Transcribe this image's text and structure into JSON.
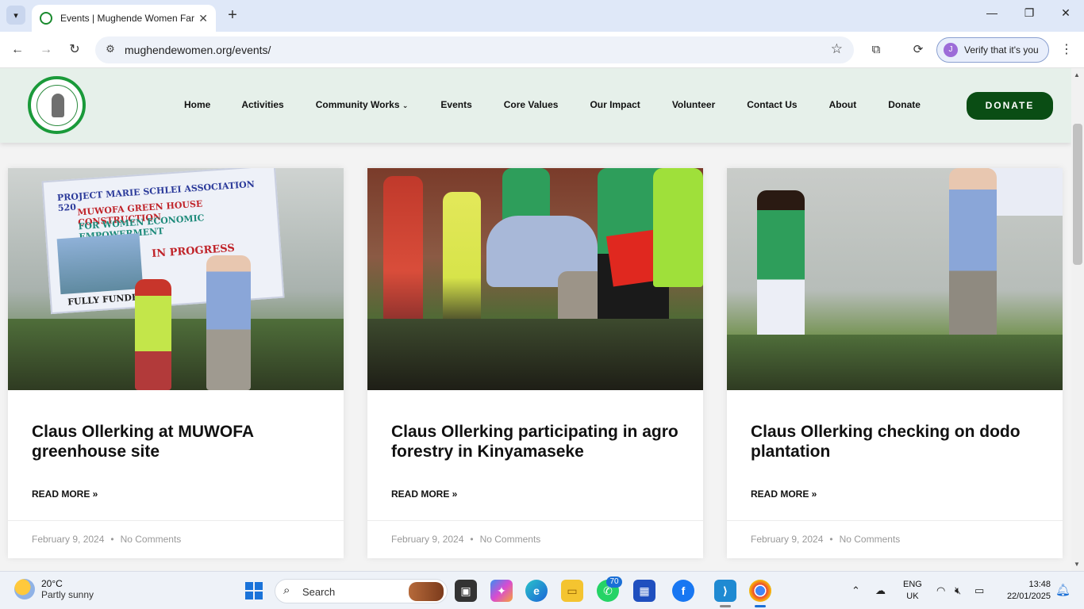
{
  "browser": {
    "tab_title": "Events | Mughende Women Far",
    "url": "mughendewomen.org/events/",
    "verify_label": "Verify that it's you",
    "avatar_letter": "J"
  },
  "site": {
    "nav": [
      "Home",
      "Activities",
      "Community Works",
      "Events",
      "Core Values",
      "Our Impact",
      "Volunteer",
      "Contact Us",
      "About",
      "Donate"
    ],
    "donate_button": "DONATE"
  },
  "posts": [
    {
      "title": "Claus Ollerking at  MUWOFA greenhouse site",
      "read_more": "READ MORE »",
      "date": "February 9, 2024",
      "comments": "No Comments"
    },
    {
      "title": "Claus Ollerking participating in agro forestry in Kinyamaseke",
      "read_more": "READ MORE »",
      "date": "February 9, 2024",
      "comments": "No Comments"
    },
    {
      "title": "Claus Ollerking checking on dodo plantation",
      "read_more": "READ MORE »",
      "date": "February 9, 2024",
      "comments": "No Comments"
    }
  ],
  "banner_text": {
    "line1": "PROJECT MARIE SCHLEI ASSOCIATION 520",
    "line2": "MUWOFA GREEN HOUSE CONSTRUCTION",
    "line3": "FOR WOMEN ECONOMIC EMPOWERMENT",
    "line4": "IN PROGRESS",
    "line5": "FULLY FUNDED BY;"
  },
  "taskbar": {
    "temperature": "20°C",
    "weather": "Partly sunny",
    "search_label": "Search",
    "whatsapp_badge": "70",
    "lang_top": "ENG",
    "lang_bottom": "UK",
    "time": "13:48",
    "date": "22/01/2025"
  },
  "colors": {
    "brand_green": "#0a4d14",
    "header_bg": "#e6f0ea",
    "accent_blue": "#1a6fd6"
  }
}
